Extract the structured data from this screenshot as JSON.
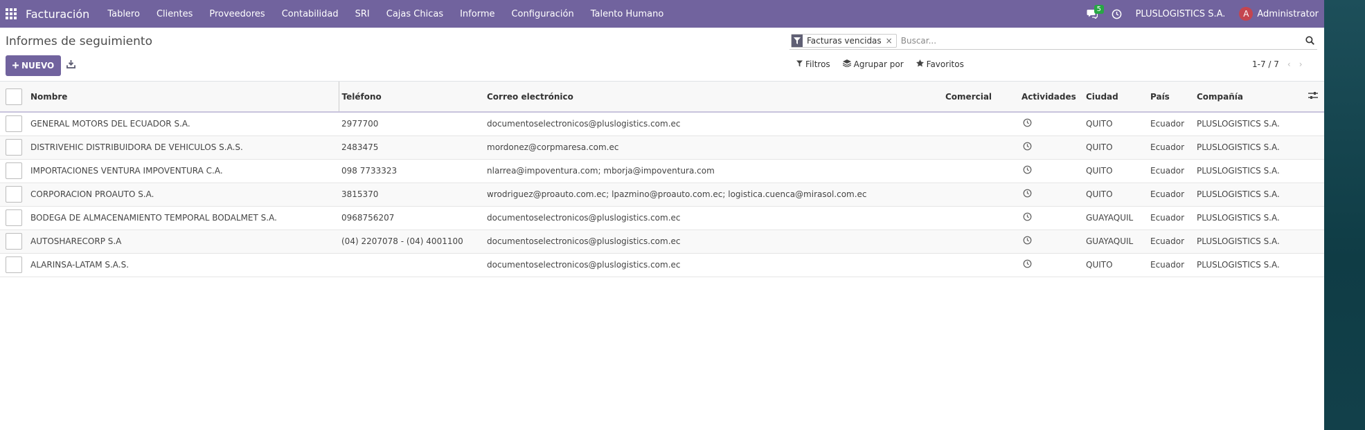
{
  "navbar": {
    "brand": "Facturación",
    "menu": [
      "Tablero",
      "Clientes",
      "Proveedores",
      "Contabilidad",
      "SRI",
      "Cajas Chicas",
      "Informe",
      "Configuración",
      "Talento Humano"
    ],
    "chat_count": "5",
    "company": "PLUSLOGISTICS S.A.",
    "avatar_letter": "A",
    "user": "Administrator"
  },
  "control": {
    "title": "Informes de seguimiento",
    "new_button": "NUEVO",
    "facet": "Facturas vencidas",
    "facet_remove": "×",
    "search_placeholder": "Buscar...",
    "filters": "Filtros",
    "group_by": "Agrupar por",
    "favorites": "Favoritos",
    "pager": "1-7 / 7",
    "pager_prev": "‹",
    "pager_next": "›"
  },
  "table": {
    "headers": {
      "name": "Nombre",
      "phone": "Teléfono",
      "email": "Correo electrónico",
      "sales": "Comercial",
      "activities": "Actividades",
      "city": "Ciudad",
      "country": "País",
      "company": "Compañía"
    },
    "rows": [
      {
        "name": "GENERAL MOTORS DEL ECUADOR S.A.",
        "phone": "2977700",
        "email": "documentoselectronicos@pluslogistics.com.ec",
        "sales": "",
        "city": "QUITO",
        "country": "Ecuador",
        "company": "PLUSLOGISTICS S.A."
      },
      {
        "name": "DISTRIVEHIC DISTRIBUIDORA DE VEHICULOS S.A.S.",
        "phone": "2483475",
        "email": "mordonez@corpmaresa.com.ec",
        "sales": "",
        "city": "QUITO",
        "country": "Ecuador",
        "company": "PLUSLOGISTICS S.A."
      },
      {
        "name": "IMPORTACIONES VENTURA IMPOVENTURA C.A.",
        "phone": "098 7733323",
        "email": "nlarrea@impoventura.com; mborja@impoventura.com",
        "sales": "",
        "city": "QUITO",
        "country": "Ecuador",
        "company": "PLUSLOGISTICS S.A."
      },
      {
        "name": "CORPORACION PROAUTO S.A.",
        "phone": "3815370",
        "email": "wrodriguez@proauto.com.ec; lpazmino@proauto.com.ec; logistica.cuenca@mirasol.com.ec",
        "sales": "",
        "city": "QUITO",
        "country": "Ecuador",
        "company": "PLUSLOGISTICS S.A."
      },
      {
        "name": "BODEGA DE ALMACENAMIENTO TEMPORAL BODALMET S.A.",
        "phone": "0968756207",
        "email": "documentoselectronicos@pluslogistics.com.ec",
        "sales": "",
        "city": "GUAYAQUIL",
        "country": "Ecuador",
        "company": "PLUSLOGISTICS S.A."
      },
      {
        "name": "AUTOSHARECORP S.A",
        "phone": "(04) 2207078 - (04) 4001100",
        "email": "documentoselectronicos@pluslogistics.com.ec",
        "sales": "",
        "city": "GUAYAQUIL",
        "country": "Ecuador",
        "company": "PLUSLOGISTICS S.A."
      },
      {
        "name": "ALARINSA-LATAM S.A.S.",
        "phone": "",
        "email": "documentoselectronicos@pluslogistics.com.ec",
        "sales": "",
        "city": "QUITO",
        "country": "Ecuador",
        "company": "PLUSLOGISTICS S.A."
      }
    ]
  }
}
